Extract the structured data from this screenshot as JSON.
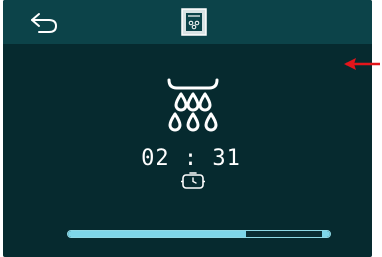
{
  "display": {
    "time": "02 : 31",
    "progress_fraction": 0.68
  },
  "topbar": {
    "back_icon": "back-arrow-icon",
    "mode_icon": "oven-steam-mode-icon"
  },
  "main": {
    "mode_icon": "steam-drops-icon",
    "timer_icon": "timer-icon"
  },
  "annotation": {
    "icon": "red-arrow-left-icon",
    "color": "#e3151b"
  },
  "colors": {
    "background": "#062a2f",
    "topbar": "#0c4349",
    "progress": "#7ed6e9",
    "text": "#ffffff"
  }
}
